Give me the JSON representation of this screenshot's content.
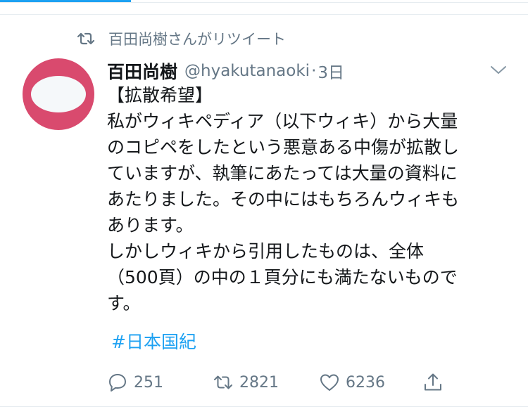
{
  "retweet_context": {
    "text": "百田尚樹さんがリツイート",
    "icon": "retweet-icon"
  },
  "tweet": {
    "author_name": "百田尚樹",
    "handle": "@hyakutanaoki",
    "separator": "·",
    "time": "3日",
    "lines": [
      "【拡散希望】",
      "私がウィキペディア（以下ウィキ）から大量",
      "のコピペをしたという悪意ある中傷が拡散し",
      "ていますが、執筆にあたっては大量の資料に",
      "あたりました。その中にはもちろんウィキも",
      "あります。",
      "しかしウィキから引用したものは、全体",
      "（500頁）の中の１頁分にも満たないもので",
      "す。"
    ],
    "hashtag": "#日本国紀"
  },
  "actions": {
    "reply_count": "251",
    "retweet_count": "2821",
    "like_count": "6236"
  },
  "colors": {
    "accent": "#1da1f2",
    "secondary_text": "#657786",
    "avatar_bg": "#d94a6e"
  }
}
